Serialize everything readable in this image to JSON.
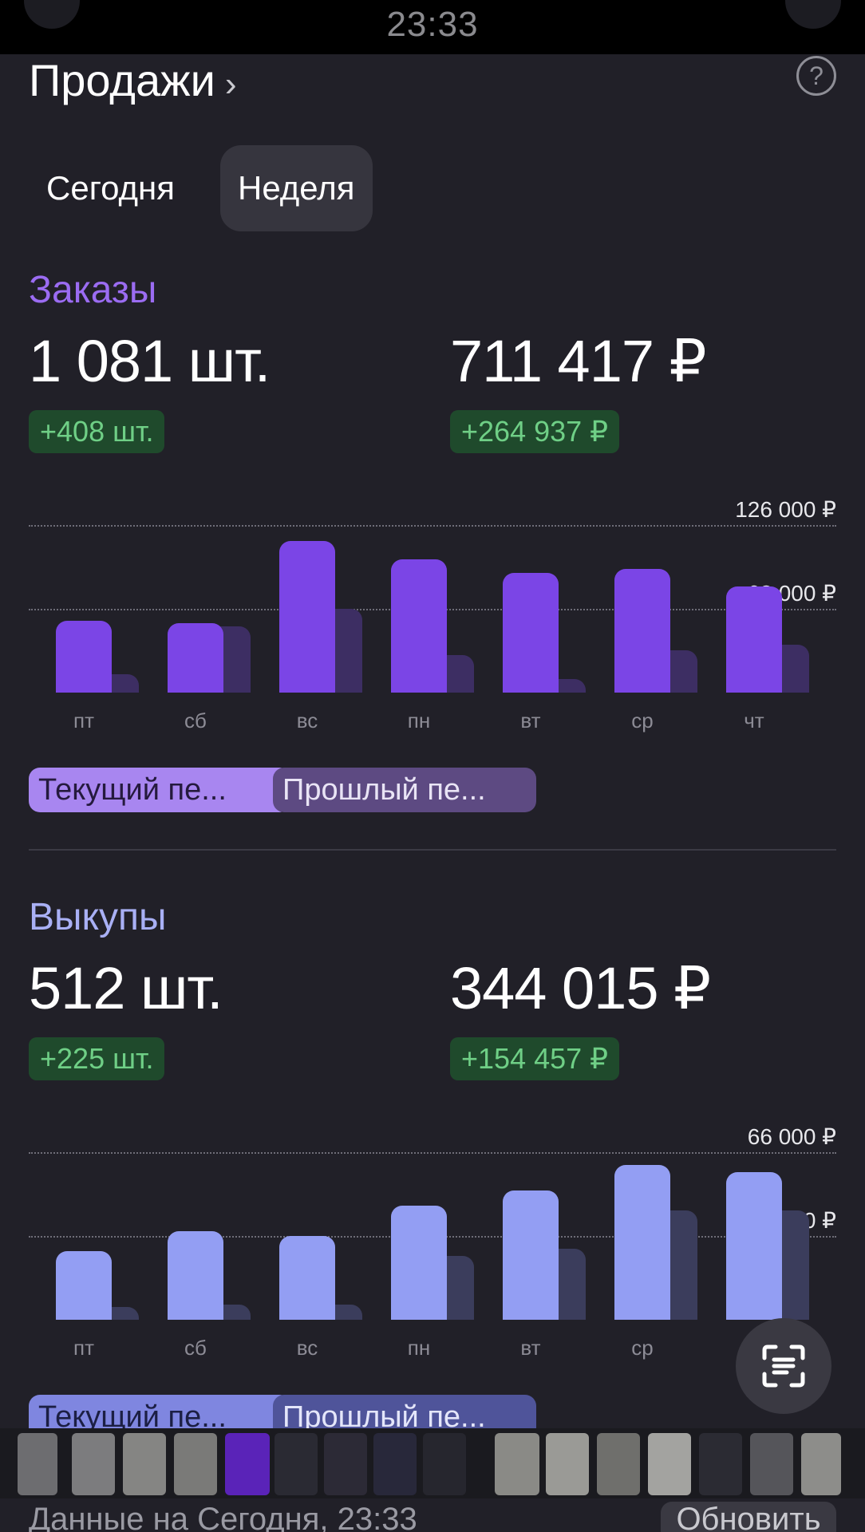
{
  "status_bar": {
    "time": "23:33"
  },
  "header": {
    "title": "Продажи",
    "chevron": "›",
    "help_icon": "question-circle-icon"
  },
  "period_tabs": [
    {
      "label": "Сегодня",
      "active": false
    },
    {
      "label": "Неделя",
      "active": true
    }
  ],
  "colors": {
    "orders_accent": "#9b6cf2",
    "orders_bar": "#7b45e6",
    "orders_bar_prev": "#3d2e63",
    "buyouts_accent": "#a9b0f5",
    "buyouts_bar": "#939ef3",
    "buyouts_bar_prev": "#3b3d5c",
    "delta_green": "#6fcf86"
  },
  "orders": {
    "label": "Заказы",
    "count": "1 081 шт.",
    "sum": "711 417 ₽",
    "count_delta": "+408 шт.",
    "sum_delta": "+264 937 ₽",
    "legend_current": "Текущий пе...",
    "legend_previous": "Прошлый пе..."
  },
  "buyouts": {
    "label": "Выкупы",
    "count": "512 шт.",
    "sum": "344 015 ₽",
    "count_delta": "+225 шт.",
    "sum_delta": "+154 457 ₽",
    "legend_current": "Текущий пе...",
    "legend_previous": "Прошлый пе..."
  },
  "chart_data": [
    {
      "type": "bar",
      "title": "Заказы",
      "categories": [
        "пт",
        "сб",
        "вс",
        "пн",
        "вт",
        "ср",
        "чт"
      ],
      "series": [
        {
          "name": "Текущий пе...",
          "values": [
            54000,
            52000,
            114000,
            100000,
            90000,
            93000,
            80000
          ]
        },
        {
          "name": "Прошлый пе...",
          "values": [
            14000,
            50000,
            63000,
            28000,
            10000,
            32000,
            36000
          ]
        }
      ],
      "y_tick_labels": [
        "63 000 ₽",
        "126 000 ₽"
      ],
      "y_ticks": [
        63000,
        126000
      ],
      "ylim": [
        0,
        126000
      ],
      "grid": true,
      "legend_placement": "bottom-left"
    },
    {
      "type": "bar",
      "title": "Выкупы",
      "categories": [
        "пт",
        "сб",
        "вс",
        "пн",
        "вт",
        "ср",
        "чт"
      ],
      "series": [
        {
          "name": "Текущий пе...",
          "values": [
            27000,
            35000,
            33000,
            45000,
            51000,
            61000,
            58000
          ]
        },
        {
          "name": "Прошлый пе...",
          "values": [
            5000,
            6000,
            6000,
            25000,
            28000,
            43000,
            43000
          ]
        }
      ],
      "y_tick_labels": [
        "33 000 ₽",
        "66 000 ₽"
      ],
      "y_ticks": [
        33000,
        66000
      ],
      "ylim": [
        0,
        66000
      ],
      "grid": true,
      "legend_placement": "bottom-left"
    }
  ],
  "scan_button": {
    "icon": "scan-text-icon"
  },
  "footer": {
    "left": "Данные на Сегодня, 23:33",
    "right": "Обновить"
  }
}
